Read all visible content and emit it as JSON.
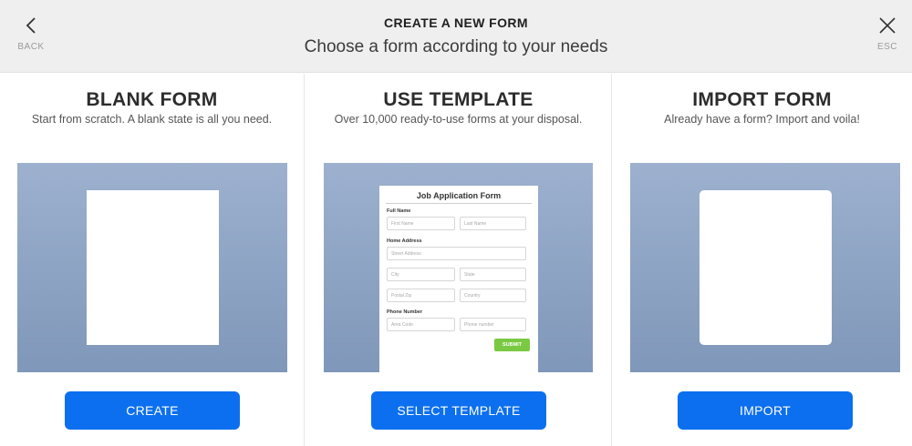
{
  "header": {
    "back_label": "BACK",
    "esc_label": "ESC",
    "title": "CREATE A NEW FORM",
    "subtitle": "Choose a form according to your needs",
    "back_icon": "chevron-left-icon",
    "close_icon": "close-icon"
  },
  "options": {
    "blank": {
      "title": "BLANK FORM",
      "description": "Start from scratch. A blank state is all you need.",
      "button": "CREATE"
    },
    "template": {
      "title": "USE TEMPLATE",
      "description": "Over 10,000 ready-to-use forms at your disposal.",
      "button": "SELECT TEMPLATE",
      "preview": {
        "form_title": "Job Application Form",
        "full_name_label": "Full Name",
        "first_name_placeholder": "First Name",
        "last_name_placeholder": "Last Name",
        "home_address_label": "Home Address",
        "street_placeholder": "Street Address",
        "city_placeholder": "City",
        "state_placeholder": "State",
        "zip_placeholder": "Postal Zip",
        "country_placeholder": "Country",
        "phone_label": "Phone Number",
        "area_code_placeholder": "Area Code",
        "phone_placeholder": "Phone number",
        "submit_label": "SUBMIT"
      }
    },
    "import": {
      "title": "IMPORT FORM",
      "description": "Already have a form? Import and voila!",
      "button": "IMPORT"
    }
  },
  "colors": {
    "button": "#0b6fef",
    "preview_bg": "#8fa5c6",
    "submit": "#7ac943",
    "header_bg": "#efefef"
  }
}
